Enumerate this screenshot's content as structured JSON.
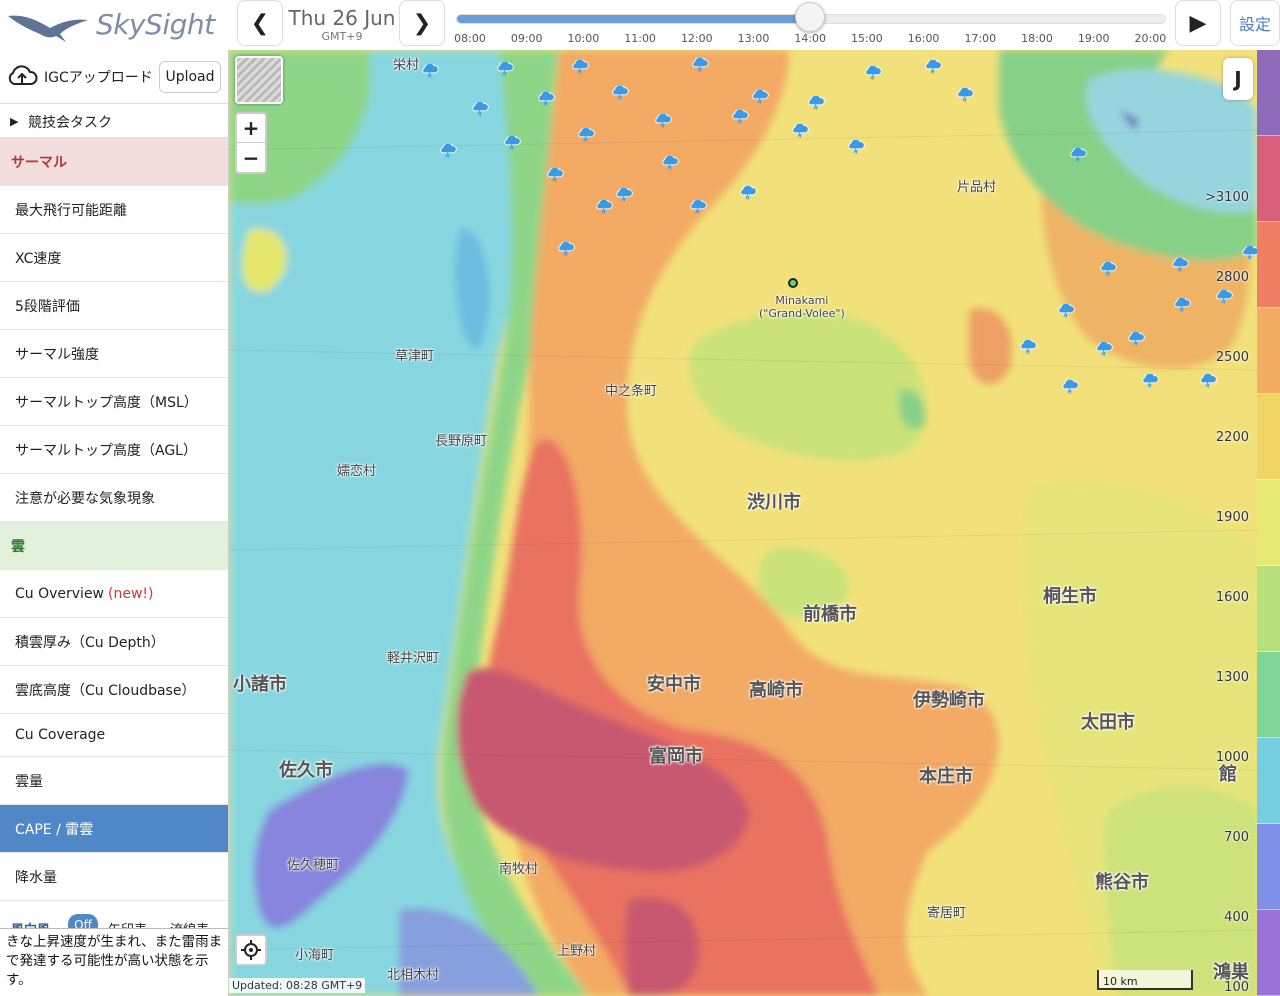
{
  "app": {
    "brand": "SkySight"
  },
  "header": {
    "date": "Thu 26 Jun",
    "timezone": "GMT+9",
    "times": [
      "08:00",
      "09:00",
      "10:00",
      "11:00",
      "12:00",
      "13:00",
      "14:00",
      "15:00",
      "16:00",
      "17:00",
      "18:00",
      "19:00",
      "20:00"
    ],
    "selected_time": "14:00",
    "settings_label": "設定",
    "icons": {
      "prev": "chevron-left-icon",
      "next": "chevron-right-icon",
      "play": "play-icon"
    }
  },
  "sidebar": {
    "igc_label": "IGCアップロード",
    "upload_label": "Upload",
    "task_label": "競技会タスク",
    "thermal_section": "サーマル",
    "thermal_items": [
      "最大飛行可能距離",
      "XC速度",
      "5段階評価",
      "サーマル強度",
      "サーマルトップ高度（MSL）",
      "サーマルトップ高度（AGL）",
      "注意が必要な気象現象"
    ],
    "cloud_section": "雲",
    "cloud_items": [
      {
        "label": "Cu Overview",
        "badge": "(new!)"
      },
      {
        "label": "積雲厚み（Cu Depth）"
      },
      {
        "label": "雲底高度（Cu Cloudbase）"
      },
      {
        "label": "Cu Coverage"
      },
      {
        "label": "雲量"
      },
      {
        "label": "CAPE / 雷雲",
        "selected": true
      },
      {
        "label": "降水量"
      }
    ],
    "wind_label": "風向風",
    "wind_off": "Off",
    "wind_opt1": "矢印表",
    "wind_opt2": "流線表",
    "description": "きな上昇速度が生まれ、また雷雨まで発達する可能性が高い状態を示す。"
  },
  "map": {
    "updated": "Updated: 08:28 GMT+9",
    "scale": "10 km",
    "j_label": "J",
    "marker_label_1": "Minakami",
    "marker_label_2": "(\"Grand-Volee\")",
    "places": [
      {
        "name": "栄村",
        "big": false
      },
      {
        "name": "片品村",
        "big": false
      },
      {
        "name": "草津町",
        "big": false
      },
      {
        "name": "中之条町",
        "big": false
      },
      {
        "name": "長野原町",
        "big": false
      },
      {
        "name": "嬬恋村",
        "big": false
      },
      {
        "name": "渋川市",
        "big": true
      },
      {
        "name": "桐生市",
        "big": true
      },
      {
        "name": "前橋市",
        "big": true
      },
      {
        "name": "軽井沢町",
        "big": false
      },
      {
        "name": "小諸市",
        "big": true
      },
      {
        "name": "安中市",
        "big": true
      },
      {
        "name": "高崎市",
        "big": true
      },
      {
        "name": "伊勢崎市",
        "big": true
      },
      {
        "name": "太田市",
        "big": true
      },
      {
        "name": "富岡市",
        "big": true
      },
      {
        "name": "佐久市",
        "big": true
      },
      {
        "name": "本庄市",
        "big": true
      },
      {
        "name": "佐久穂町",
        "big": false
      },
      {
        "name": "南牧村",
        "big": false
      },
      {
        "name": "熊谷市",
        "big": true
      },
      {
        "name": "寄居町",
        "big": false
      },
      {
        "name": "上野村",
        "big": false
      },
      {
        "name": "小海町",
        "big": false
      },
      {
        "name": "北相木村",
        "big": false
      },
      {
        "name": "館",
        "big": true
      },
      {
        "name": "鴻巣",
        "big": true
      }
    ],
    "legend_values": [
      ">3100",
      "2800",
      "2500",
      "2200",
      "1900",
      "1600",
      "1300",
      "1000",
      "700",
      "400",
      "100"
    ]
  },
  "legend_colors": [
    "#8e6bb8",
    "#d9607a",
    "#ee7f63",
    "#f2ad62",
    "#f0d563",
    "#e6ea74",
    "#b8e07a",
    "#7fd49a",
    "#74cde0",
    "#7e8fe8",
    "#9a73d8"
  ]
}
